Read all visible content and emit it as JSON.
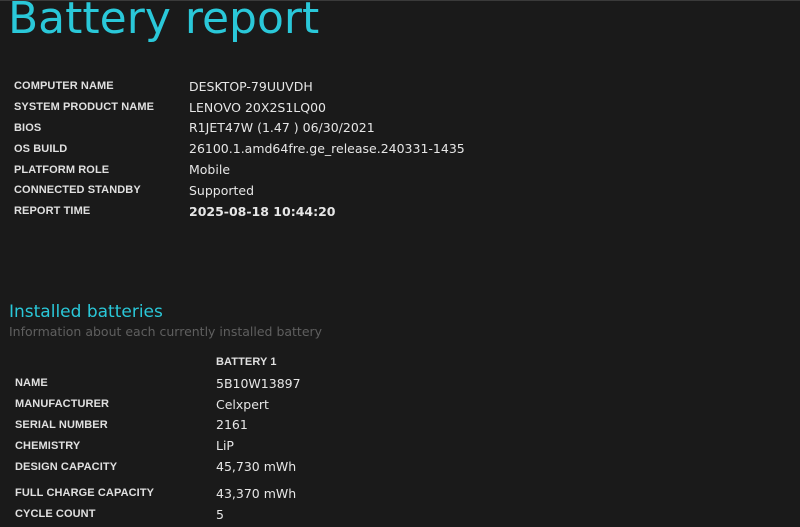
{
  "report": {
    "title": "Battery report"
  },
  "system_info": [
    {
      "label": "COMPUTER NAME",
      "value": "DESKTOP-79UUVDH"
    },
    {
      "label": "SYSTEM PRODUCT NAME",
      "value": "LENOVO 20X2S1LQ00"
    },
    {
      "label": "BIOS",
      "value": "R1JET47W (1.47 ) 06/30/2021"
    },
    {
      "label": "OS BUILD",
      "value": "26100.1.amd64fre.ge_release.240331-1435"
    },
    {
      "label": "PLATFORM ROLE",
      "value": "Mobile"
    },
    {
      "label": "CONNECTED STANDBY",
      "value": "Supported"
    },
    {
      "label": "REPORT TIME",
      "value": "2025-08-18  10:44:20"
    }
  ],
  "installed_batteries": {
    "title": "Installed batteries",
    "subtitle": "Information about each currently installed battery",
    "battery_header": "BATTERY 1",
    "rows": [
      {
        "label": "NAME",
        "value": "5B10W13897"
      },
      {
        "label": "MANUFACTURER",
        "value": "Celxpert"
      },
      {
        "label": "SERIAL NUMBER",
        "value": "2161"
      },
      {
        "label": "CHEMISTRY",
        "value": "LiP"
      },
      {
        "label": "DESIGN CAPACITY",
        "value": "45,730 mWh"
      },
      {
        "label": "FULL CHARGE CAPACITY",
        "value": "43,370 mWh"
      },
      {
        "label": "CYCLE COUNT",
        "value": "5"
      }
    ]
  },
  "colors": {
    "background": "#1a1a1a",
    "accent": "#2ac8d9",
    "text": "#e4e4e4",
    "muted": "#5f5f5f"
  }
}
